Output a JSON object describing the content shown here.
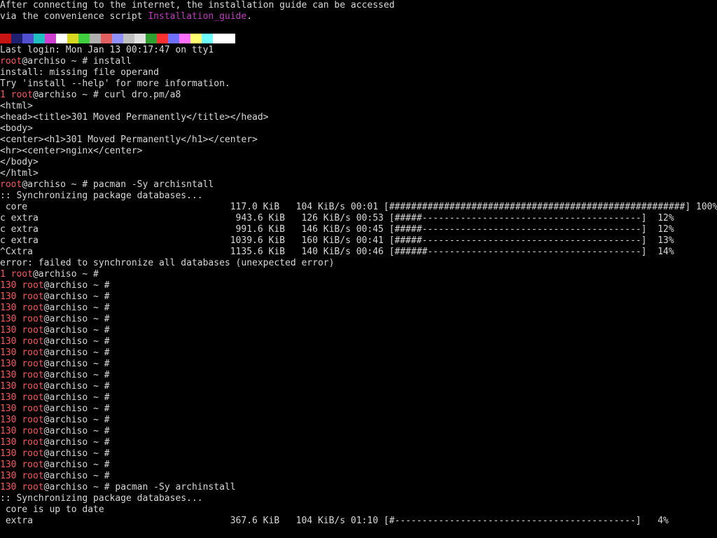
{
  "intro": {
    "line1": "After connecting to the internet, the installation guide can be accessed",
    "line2_prefix": "via the convenience script ",
    "line2_link": "Installation_guide",
    "line2_suffix": "."
  },
  "colorbar": {
    "colors": [
      "#c81414",
      "#202070",
      "#5050d0",
      "#20c0c0",
      "#d040d0",
      "#ffffff",
      "#d8d820",
      "#40d040",
      "#b0b0b0",
      "#e06060",
      "#9090ff",
      "#c0c0c0",
      "#e0e0e0",
      "#30a030",
      "#ff3030",
      "#7070ff",
      "#ff70ff",
      "#ffff70",
      "#70ffff",
      "#ffffff"
    ]
  },
  "terminal": {
    "last_login": "Last login: Mon Jan 13 00:17:47 on tty1",
    "user": "root",
    "host_suffix": "@archiso ~ #",
    "exit_1": "1",
    "exit_130": "130",
    "cmd_install": " install",
    "err_missing": "install: missing file operand",
    "err_try": "Try 'install --help' for more information.",
    "cmd_curl": " curl dro.pm/a8",
    "html_lines": [
      "<html>",
      "<head><title>301 Moved Permanently</title></head>",
      "<body>",
      "<center><h1>301 Moved Permanently</h1></center>",
      "<hr><center>nginx</center>",
      "</body>",
      "</html>"
    ],
    "cmd_pacman1": " pacman -Sy archisntall",
    "sync_msg": ":: Synchronizing package databases...",
    "sync_rows_1": [
      " core                                     117.0 KiB   104 KiB/s 00:01 [######################################################] 100%",
      "c extra                                    943.6 KiB   126 KiB/s 00:53 [#####----------------------------------------]  12%",
      "c extra                                    991.6 KiB   146 KiB/s 00:45 [#####----------------------------------------]  12%",
      "c extra                                   1039.6 KiB   160 KiB/s 00:41 [#####----------------------------------------]  13%",
      "^Cxtra                                    1135.6 KiB   140 KiB/s 00:46 [######---------------------------------------]  14%"
    ],
    "sync_error": "error: failed to synchronize all databases (unexpected error)",
    "cmd_pacman2": " pacman -Sy archinstall",
    "core_uptodate": " core is up to date",
    "extra_row": " extra                                    367.6 KiB   104 KiB/s 01:10 [#--------------------------------------------]   4%"
  }
}
